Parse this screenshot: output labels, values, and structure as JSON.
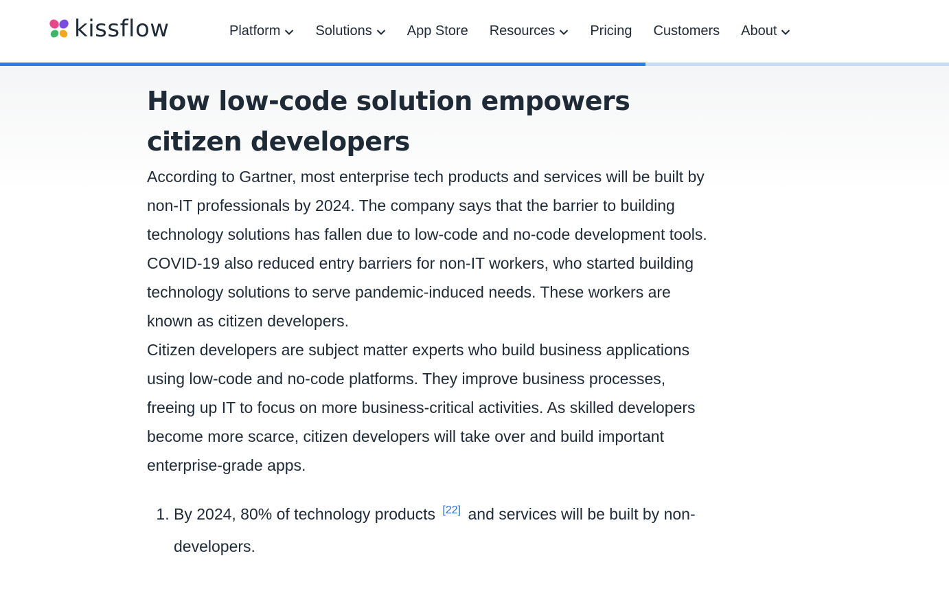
{
  "brand": {
    "name": "kissflow",
    "logo_colors": [
      "#e8478b",
      "#7b4ce0",
      "#3fb56b",
      "#f2a81d"
    ]
  },
  "nav": {
    "items": [
      {
        "label": "Platform",
        "has_dropdown": true
      },
      {
        "label": "Solutions",
        "has_dropdown": true
      },
      {
        "label": "App Store",
        "has_dropdown": false
      },
      {
        "label": "Resources",
        "has_dropdown": true
      },
      {
        "label": "Pricing",
        "has_dropdown": false
      },
      {
        "label": "Customers",
        "has_dropdown": false
      },
      {
        "label": "About",
        "has_dropdown": true
      }
    ]
  },
  "reading_progress": {
    "fraction": 0.68,
    "fill_color": "#2f7be8",
    "track_color": "#c6dcf7"
  },
  "article": {
    "title": "How low-code solution empowers citizen developers",
    "paragraphs": [
      "According to Gartner, most enterprise tech products and services will be built by non-IT professionals by 2024. The company says that the barrier to building technology solutions has fallen due to low-code and no-code development tools. COVID-19 also reduced entry barriers for non-IT workers, who started building technology solutions to serve pandemic-induced needs. These workers are known as citizen developers.",
      "Citizen developers are subject matter experts who build business applications using low-code and no-code platforms. They improve business processes, freeing up IT to focus on more business-critical activities. As skilled developers become more scarce, citizen developers will take over and build important enterprise-grade apps."
    ],
    "list": [
      {
        "before": "By 2024, 80% of technology products",
        "cite": "[22]",
        "after": "and services will be built by non-developers."
      }
    ]
  }
}
